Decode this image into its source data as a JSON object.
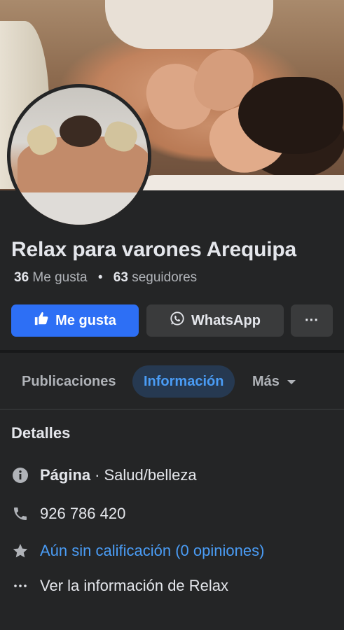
{
  "page": {
    "name": "Relax para varones Arequipa",
    "likes_count": "36",
    "likes_label": "Me gusta",
    "followers_count": "63",
    "followers_label": "seguidores",
    "separator": "•"
  },
  "actions": {
    "like_label": "Me gusta",
    "whatsapp_label": "WhatsApp",
    "more_label": "···"
  },
  "tabs": [
    {
      "label": "Publicaciones"
    },
    {
      "label": "Información",
      "active": true
    },
    {
      "label": "Más"
    }
  ],
  "details": {
    "title": "Detalles",
    "page_label": "Página",
    "page_separator": "·",
    "category": "Salud/belleza",
    "phone": "926 786 420",
    "rating": "Aún sin calificación (0 opiniones)",
    "more_info": "Ver la información de Relax"
  },
  "colors": {
    "background": "#242526",
    "accent": "#2d6ff5",
    "link": "#4a9cf5"
  },
  "icons": [
    "thumbs-up-icon",
    "whatsapp-icon",
    "more-icon",
    "chevron-down-icon",
    "info-icon",
    "phone-icon",
    "star-icon",
    "ellipsis-icon"
  ]
}
